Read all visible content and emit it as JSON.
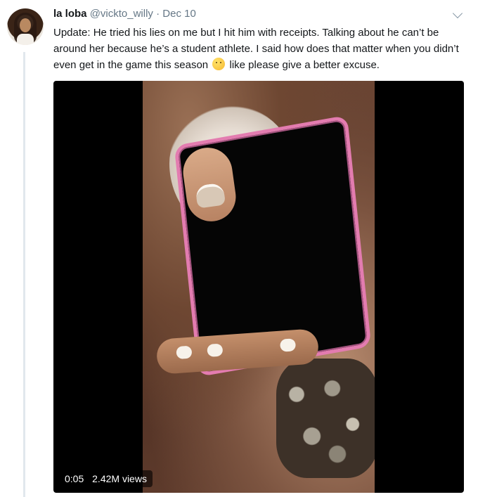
{
  "tweet": {
    "author_name": "la loba",
    "handle": "@vickto_willy",
    "separator": "·",
    "date": "Dec 10",
    "text_before_emoji": "Update: He tried his lies on me but I hit him with receipts. Talking about he can’t be around her because he’s a student athlete. I said how does that matter when you didn’t even get in the game this season",
    "emoji": "thinking-face",
    "text_after_emoji": " like please give a better excuse."
  },
  "video": {
    "duration": "0:05",
    "views": "2.42M views"
  },
  "colors": {
    "name": "#14171a",
    "secondary": "#657786",
    "phone_case": "#e37cb0"
  }
}
